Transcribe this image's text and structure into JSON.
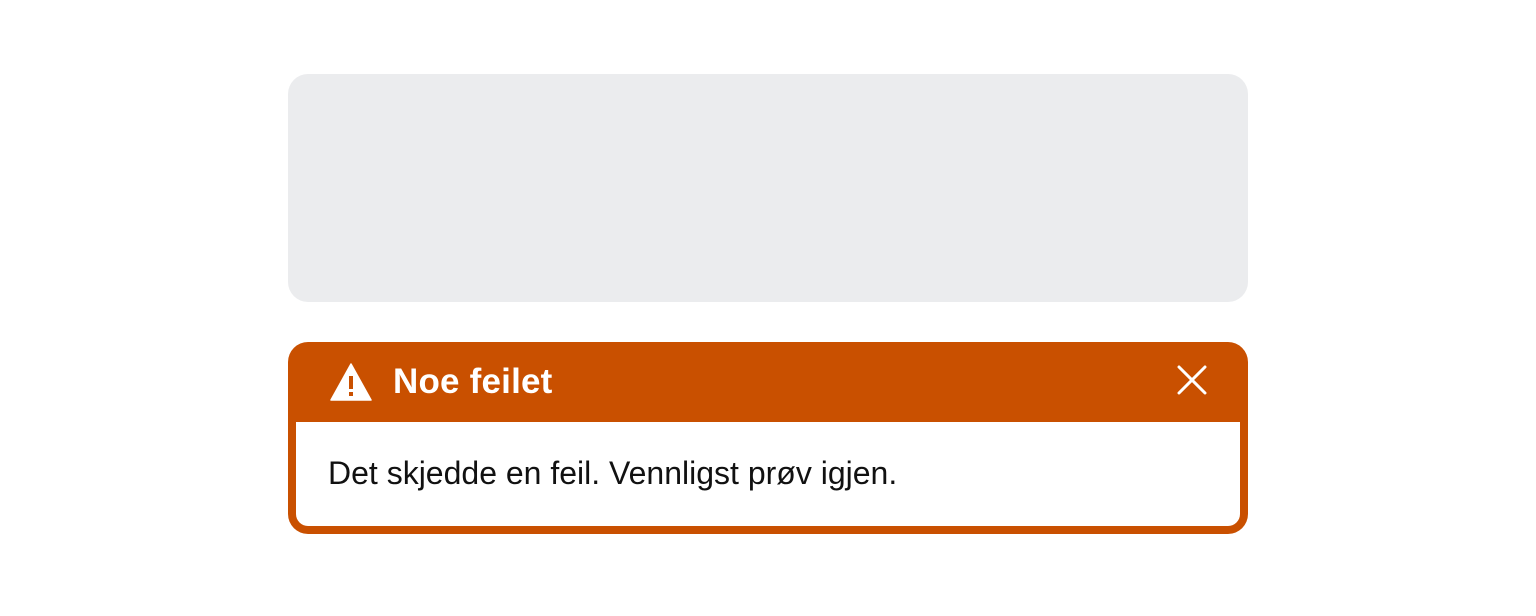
{
  "alert": {
    "title": "Noe feilet",
    "message": "Det skjedde en feil. Vennligst prøv igjen.",
    "icon": "warning-triangle-icon",
    "close_icon": "close-icon",
    "accent_color": "#c95000"
  },
  "placeholder": {
    "background_color": "#ebecee"
  }
}
